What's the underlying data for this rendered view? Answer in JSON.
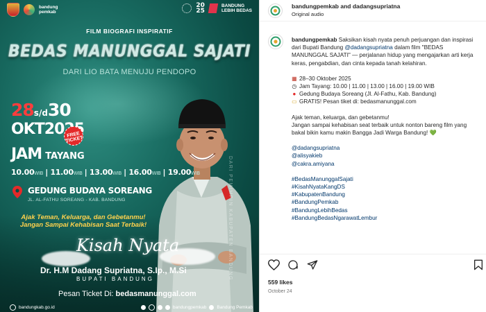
{
  "poster": {
    "brand_left_line1": "bandung",
    "brand_left_line2": "pemkab",
    "year_logo_top": "20",
    "year_logo_bottom": "25",
    "brand_right_line1": "BANDUNG",
    "brand_right_line2": "LEBIH BEDAS",
    "film_label": "FILM BIOGRAFI INSPIRATIF",
    "title": "BEDAS MANUNGGAL SAJATI",
    "subtitle": "DARI LIO BATA MENUJU PENDOPO",
    "date_start": "28",
    "date_sep": "s/d",
    "date_end": "30",
    "date_month_year": "OKT2025",
    "badge_line1": "FREE",
    "badge_line2": "TICKET",
    "jam_label": "JAM",
    "tayang_label": "TAYANG",
    "showtimes": [
      "10.00",
      "11.00",
      "13.00",
      "16.00",
      "19.00"
    ],
    "timezone": "WIB",
    "venue": "GEDUNG BUDAYA SOREANG",
    "venue_address": "JL. AL-FATHU SOREANG - KAB. BANDUNG",
    "invite_line1": "Ajak Teman, Keluarga, dan Gebetanmu!",
    "invite_line2": "Jangan Sampai Kehabisan Saat Terbaik!",
    "kisah": "Kisah Nyata",
    "person_name": "Dr. H.M Dadang Supriatna, S.Ip., M.Si",
    "person_role": "BUPATI BANDUNG",
    "ticket_prefix": "Pesan Ticket Di:",
    "ticket_url": "bedasmanunggal.com",
    "footer_site": "bandungkab.go.id",
    "footer_handle": "bandungpemkab",
    "footer_page": "Bandung Pemkab",
    "vertical_text": "DARI PEMIMPIN KABUPATEN BANDUNG"
  },
  "post": {
    "header_user": "bandungpemkab and dadangsupriatna",
    "header_audio": "Original audio",
    "caption_user": "bandungpemkab",
    "caption_text_1": "Saksikan kisah nyata penuh perjuangan dan inspirasi dari Bupati Bandung",
    "caption_mention": "@dadangsupriatna",
    "caption_text_2": "dalam film \"BEDAS MANUNGGAL SAJATI\" — perjalanan hidup yang mengajarkan arti kerja keras, pengabdian, dan cinta kepada tanah kelahiran.",
    "detail_date": "28–30 Oktober 2025",
    "detail_time": "Jam Tayang: 10.00 | 11.00 | 13.00 | 16.00 | 19.00 WIB",
    "detail_place": "Gedung Budaya Soreang (Jl. Al-Fathu, Kab. Bandung)",
    "detail_ticket": "GRATIS! Pesan tiket di: bedasmanunggal.com",
    "invite_line1": "Ajak teman, keluarga, dan gebetanmu!",
    "invite_line2": "Jangan sampai kehabisan seat terbaik untuk nonton bareng film yang bakal bikin kamu makin Bangga Jadi Warga Bandung! 💚",
    "mentions": [
      "@dadangsupriatna",
      "@alisyakieb",
      "@cakra.amiyana"
    ],
    "hashtags": [
      "#BedasManunggalSajati",
      "#KisahNyataKangDS",
      "#KabupatenBandung",
      "#BandungPemkab",
      "#BandungLebihBedas",
      "#BandungBedasNgarawatLembur"
    ],
    "likes": "559 likes",
    "date": "October 24"
  },
  "icons": {
    "detail_date": "calendar-icon",
    "detail_time": "clock-icon",
    "detail_place": "pin-icon",
    "detail_ticket": "ticket-icon"
  },
  "colors": {
    "poster_teal": "#17685e",
    "accent_red": "#e42a2a",
    "accent_yellow": "#ffd24d",
    "link": "#00376b"
  }
}
